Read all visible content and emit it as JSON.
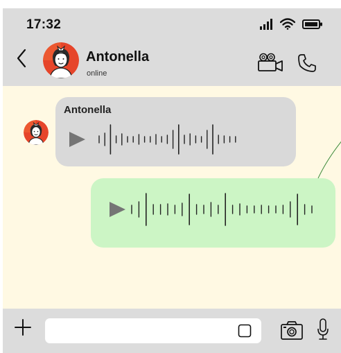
{
  "status_bar": {
    "time": "17:32"
  },
  "header": {
    "contact_name": "Antonella",
    "contact_status": "online",
    "icons": {
      "back": "chevron-left-icon",
      "video": "video-camera-icon",
      "call": "phone-icon"
    }
  },
  "messages": [
    {
      "direction": "incoming",
      "sender": "Antonella",
      "type": "voice",
      "waveform_heights": [
        10,
        18,
        42,
        10,
        16,
        8,
        8,
        14,
        8,
        8,
        14,
        8,
        12,
        26,
        42,
        12,
        16,
        10,
        8,
        26,
        42,
        12,
        10,
        8,
        8
      ]
    },
    {
      "direction": "outgoing",
      "type": "voice",
      "waveform_heights": [
        12,
        22,
        46,
        14,
        14,
        16,
        12,
        18,
        44,
        14,
        12,
        20,
        12,
        46,
        12,
        16,
        10,
        10,
        12,
        10,
        10,
        12,
        22,
        44,
        14,
        10
      ]
    }
  ],
  "input_bar": {
    "message_value": "",
    "icons": {
      "add": "plus-icon",
      "sticker": "sticker-icon",
      "camera": "camera-icon",
      "mic": "microphone-icon"
    }
  },
  "colors": {
    "header_bg": "#dcdcdc",
    "chat_bg": "#fff9e3",
    "incoming_bubble": "#d9d9d9",
    "outgoing_bubble": "#ccf5c5",
    "play_button": "#757575",
    "avatar_bg": "#e6452a"
  }
}
